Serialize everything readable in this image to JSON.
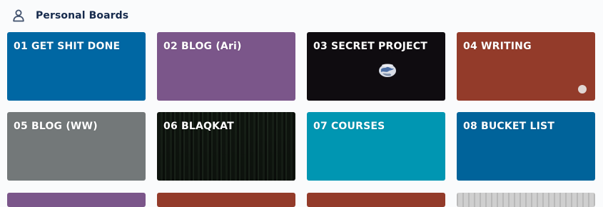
{
  "section": {
    "title": "Personal Boards",
    "icon": "person-icon"
  },
  "boards": [
    {
      "label": "01 GET SHIT DONE",
      "color": "#0067a3"
    },
    {
      "label": "02 BLOG (Ari)",
      "color": "#7b568a"
    },
    {
      "label": "03 SECRET PROJECT",
      "background": "earth-in-space-image"
    },
    {
      "label": "04 WRITING",
      "color": "#933b2a"
    },
    {
      "label": "05 BLOG (WW)",
      "color": "#737879"
    },
    {
      "label": "06 BLAQKAT",
      "background": "dark-forest-image"
    },
    {
      "label": "07 COURSES",
      "color": "#0096b2"
    },
    {
      "label": "08 BUCKET LIST",
      "color": "#00639a"
    }
  ],
  "next_row_colors": [
    "#7b568a",
    "#933b2a",
    "#933b2a",
    "#c9c9c9"
  ]
}
